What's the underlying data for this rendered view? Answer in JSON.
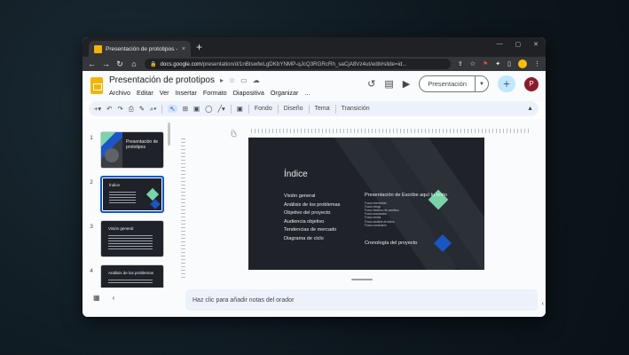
{
  "browser": {
    "tab_title": "Presentación de prototipos - Pre...",
    "tab_close": "×",
    "new_tab": "+",
    "window_controls": [
      "—",
      "▢",
      "✕"
    ],
    "nav": [
      "←",
      "→",
      "↻",
      "⌂"
    ],
    "url_domain": "docs.google.com",
    "url_path": "/presentation/d/1nBtswfwLgDKbYNMP-qJcQ3RGRcRh_saCjA8Vz4ut/edit#slide=id..."
  },
  "docs": {
    "title": "Presentación de prototipos",
    "menu": [
      "Archivo",
      "Editar",
      "Ver",
      "Insertar",
      "Formato",
      "Diapositiva",
      "Organizar",
      "..."
    ],
    "present_label": "Presentación",
    "account_initial": "P"
  },
  "toolbar": {
    "layout": "Fondo",
    "theme": "Diseño",
    "tema": "Tema",
    "transition": "Transición"
  },
  "filmstrip": [
    {
      "num": "1",
      "label": "Presentación de prototipos"
    },
    {
      "num": "2",
      "label": "Índice"
    },
    {
      "num": "3",
      "label": "Visión general"
    },
    {
      "num": "4",
      "label": "Análisis de los problemas"
    }
  ],
  "slide": {
    "heading": "Índice",
    "left_items": [
      "Visión general",
      "Análisis de los problemas",
      "Objetivo del proyecto",
      "Audiencia objetivo",
      "Tendencias de mercado",
      "Diagrama de ciclo"
    ],
    "right_title": "Presentación de Escribe aquí tu texto",
    "right_sub": [
      "Focus intermedia",
      "Focus riesgo",
      "Focus histórico de cambios",
      "Focus avanzados",
      "Focus media",
      "Focus análisis de datos",
      "Focus conclusión"
    ],
    "right_bottom": "Cronología del proyecto"
  },
  "notes_placeholder": "Haz clic para añadir notas del orador",
  "colors": {
    "accent": "#0b57d0",
    "slide_bg": "#1f2329",
    "green": "#7bd3a8",
    "blue": "#1a56c7"
  }
}
